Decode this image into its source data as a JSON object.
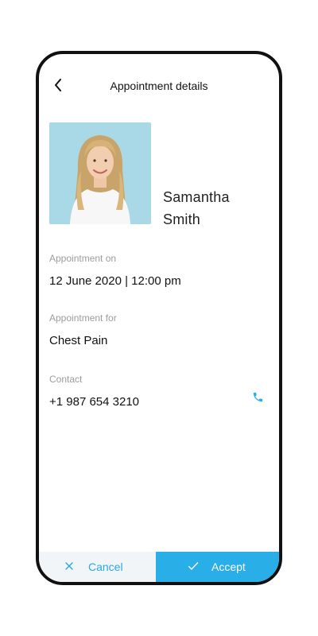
{
  "header": {
    "title": "Appointment details",
    "back_icon": "chevron-left-icon"
  },
  "profile": {
    "first_name": "Samantha",
    "last_name": "Smith"
  },
  "appointment": {
    "on_label": "Appointment on",
    "on_value": "12 June 2020 | 12:00 pm",
    "for_label": "Appointment for",
    "for_value": "Chest Pain",
    "contact_label": "Contact",
    "contact_value": "+1 987 654 3210"
  },
  "actions": {
    "cancel_label": "Cancel",
    "accept_label": "Accept"
  },
  "colors": {
    "accent": "#2aaee8",
    "cancel_bg": "#f1f5f7",
    "photo_bg": "#a9d8e6"
  }
}
